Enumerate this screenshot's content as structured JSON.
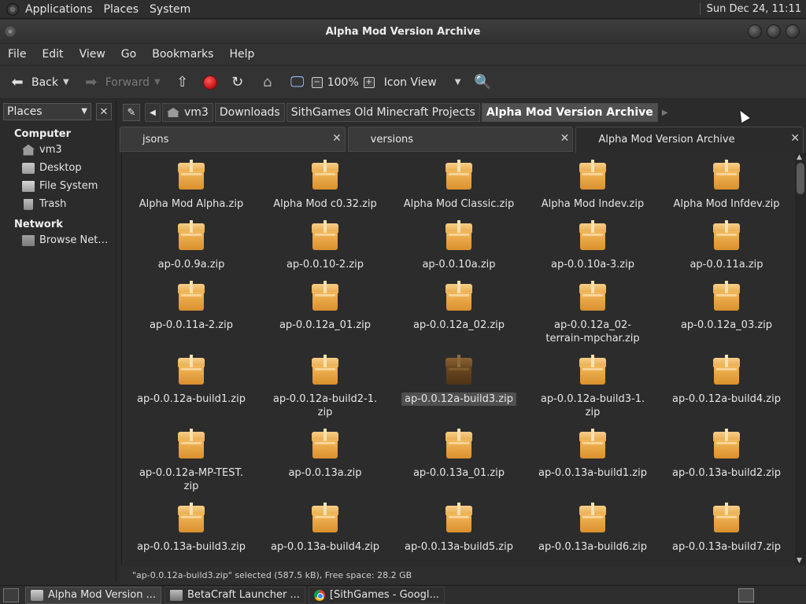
{
  "top_panel": {
    "menus": [
      "Applications",
      "Places",
      "System"
    ],
    "clock": "Sun Dec 24, 11:11"
  },
  "window": {
    "title": "Alpha Mod Version Archive"
  },
  "menubar": [
    "File",
    "Edit",
    "View",
    "Go",
    "Bookmarks",
    "Help"
  ],
  "toolbar": {
    "back_label": "Back",
    "forward_label": "Forward",
    "zoom": "100%",
    "view_mode": "Icon View"
  },
  "sidepane": {
    "selector": "Places",
    "close_glyph": "✕",
    "computer_header": "Computer",
    "computer_items": [
      "vm3",
      "Desktop",
      "File System",
      "Trash"
    ],
    "network_header": "Network",
    "network_items": [
      "Browse Net…"
    ]
  },
  "pathbar": {
    "crumbs": [
      "vm3",
      "Downloads",
      "SithGames Old Minecraft Projects",
      "Alpha Mod Version Archive"
    ]
  },
  "tabs": [
    {
      "label": "jsons"
    },
    {
      "label": "versions"
    },
    {
      "label": "Alpha Mod Version Archive"
    }
  ],
  "files": [
    [
      "Alpha Mod Alpha.zip",
      "Alpha Mod c0.32.zip",
      "Alpha Mod Classic.zip",
      "Alpha Mod Indev.zip",
      "Alpha Mod Infdev.zip"
    ],
    [
      "ap-0.0.9a.zip",
      "ap-0.0.10-2.zip",
      "ap-0.0.10a.zip",
      "ap-0.0.10a-3.zip",
      "ap-0.0.11a.zip"
    ],
    [
      "ap-0.0.11a-2.zip",
      "ap-0.0.12a_01.zip",
      "ap-0.0.12a_02.zip",
      "ap-0.0.12a_02-terrain-mpchar.zip",
      "ap-0.0.12a_03.zip"
    ],
    [
      "ap-0.0.12a-build1.zip",
      "ap-0.0.12a-build2-1.zip",
      "ap-0.0.12a-build3.zip",
      "ap-0.0.12a-build3-1.zip",
      "ap-0.0.12a-build4.zip"
    ],
    [
      "ap-0.0.12a-MP-TEST.zip",
      "ap-0.0.13a.zip",
      "ap-0.0.13a_01.zip",
      "ap-0.0.13a-build1.zip",
      "ap-0.0.13a-build2.zip"
    ],
    [
      "ap-0.0.13a-build3.zip",
      "ap-0.0.13a-build4.zip",
      "ap-0.0.13a-build5.zip",
      "ap-0.0.13a-build6.zip",
      "ap-0.0.13a-build7.zip"
    ]
  ],
  "file_label_lines": {
    "ap-0.0.12a_02-terrain-mpchar.zip": [
      "ap-0.0.12a_02-",
      "terrain-mpchar.zip"
    ],
    "ap-0.0.12a-build2-1.zip": [
      "ap-0.0.12a-build2-1.",
      "zip"
    ],
    "ap-0.0.12a-build3-1.zip": [
      "ap-0.0.12a-build3-1.",
      "zip"
    ],
    "ap-0.0.12a-MP-TEST.zip": [
      "ap-0.0.12a-MP-TEST.",
      "zip"
    ]
  },
  "selected_file": "ap-0.0.12a-build3.zip",
  "status": "\"ap-0.0.12a-build3.zip\" selected (587.5 kB), Free space: 28.2 GB",
  "taskbar": [
    {
      "label": "Alpha Mod Version ...",
      "icon": "folder-icon",
      "active": true
    },
    {
      "label": "BetaCraft Launcher ...",
      "icon": "app-icon",
      "active": false
    },
    {
      "label": "[SithGames - Googl...",
      "icon": "chrome-icon",
      "active": false
    }
  ],
  "colors": {
    "panel_bg": "#2e2e2e",
    "window_bg": "#2b2b2b",
    "package_orange": "#e7a94b",
    "selected_label": "#505050"
  }
}
